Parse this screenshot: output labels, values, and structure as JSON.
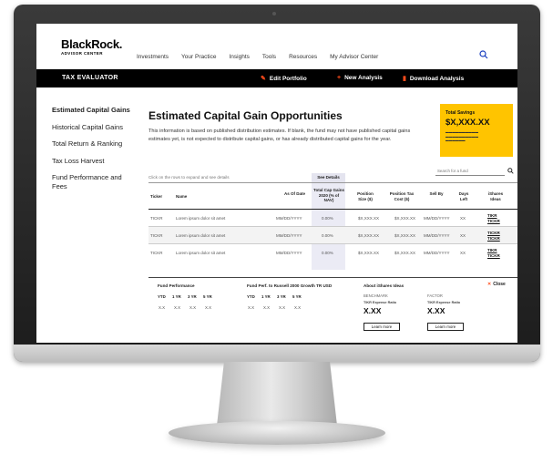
{
  "brand": {
    "name": "BlackRock.",
    "subtitle": "ADVISOR CENTER"
  },
  "nav": {
    "items": [
      "Investments",
      "Your Practice",
      "Insights",
      "Tools",
      "Resources",
      "My Advisor Center"
    ],
    "search_icon": "search-icon"
  },
  "toolbar": {
    "title": "TAX EVALUATOR",
    "edit_portfolio": "Edit Portfolio",
    "new_analysis": "New Analysis",
    "download_analysis": "Download Analysis",
    "accent_color": "#ff4c1c"
  },
  "sidebar": {
    "items": [
      "Estimated Capital Gains",
      "Historical Capital Gains",
      "Total Return & Ranking",
      "Tax Loss Harvest",
      "Fund Performance and Fees"
    ],
    "active_index": 0
  },
  "main": {
    "title": "Estimated Capital Gain Opportunities",
    "description": "This information is based on published distribution estimates. If blank, the fund may not have published capital gains estimates yet, is not expected to distribute capital gains, or has already distributed capital gains for the year.",
    "hint": "Click on the rows to expand and see details",
    "search_placeholder": "Search for a fund",
    "see_details": "See Details"
  },
  "savings": {
    "label": "Total Savings",
    "value": "$X,XXX.XX",
    "color": "#ffc400"
  },
  "table": {
    "headers": {
      "ticker": "Ticker",
      "name": "Name",
      "as_of": "As Of Date",
      "total_cap": "Total Cap Gains 2020 (% of NAV)",
      "position_size": "Position Size ($)",
      "position_tax": "Position Tax Cost ($)",
      "sell_by": "Sell By",
      "days_left": "Days Left",
      "ideas": "iShares Ideas"
    },
    "rows": [
      {
        "ticker": "TICKR",
        "name": "Lorem ipsum dolor sit amet",
        "as_of": "MM/DD/YYYY",
        "total_cap": "0.00%",
        "position_size": "$X,XXX.XX",
        "position_tax": "$X,XXX.XX",
        "sell_by": "MM/DD/YYYY",
        "days_left": "XX",
        "idea1": "TIKR",
        "idea2": "TICKR"
      },
      {
        "ticker": "TICKR",
        "name": "Lorem ipsum dolor sit amet",
        "as_of": "MM/DD/YYYY",
        "total_cap": "0.00%",
        "position_size": "$X,XXX.XX",
        "position_tax": "$X,XXX.XX",
        "sell_by": "MM/DD/YYYY",
        "days_left": "XX",
        "idea1": "TICKR",
        "idea2": "TICKR"
      },
      {
        "ticker": "TICKR",
        "name": "Lorem ipsum dolor sit amet",
        "as_of": "MM/DD/YYYY",
        "total_cap": "0.00%",
        "position_size": "$X,XXX.XX",
        "position_tax": "$X,XXX.XX",
        "sell_by": "MM/DD/YYYY",
        "days_left": "XX",
        "idea1": "TIKR",
        "idea2": "TICKR"
      }
    ]
  },
  "detail": {
    "fund_performance": "Fund Performance",
    "fund_vs_index": "Fund Perf. to Russell 2000 Growth TR USD",
    "periods": [
      "YTD",
      "1 YR",
      "3 YR",
      "5 YR"
    ],
    "values": [
      "X.X",
      "X.X",
      "X.X",
      "X.X"
    ],
    "about": "About iShares Ideas",
    "close": "Close",
    "alternatives": [
      {
        "name": "BENCHMARK",
        "sub": "TIKR Expense Ratio",
        "value": "X.XX",
        "button": "Learn more"
      },
      {
        "name": "FACTOR",
        "sub": "TIKR Expense Ratio",
        "value": "X.XX",
        "button": "Learn more"
      }
    ]
  }
}
